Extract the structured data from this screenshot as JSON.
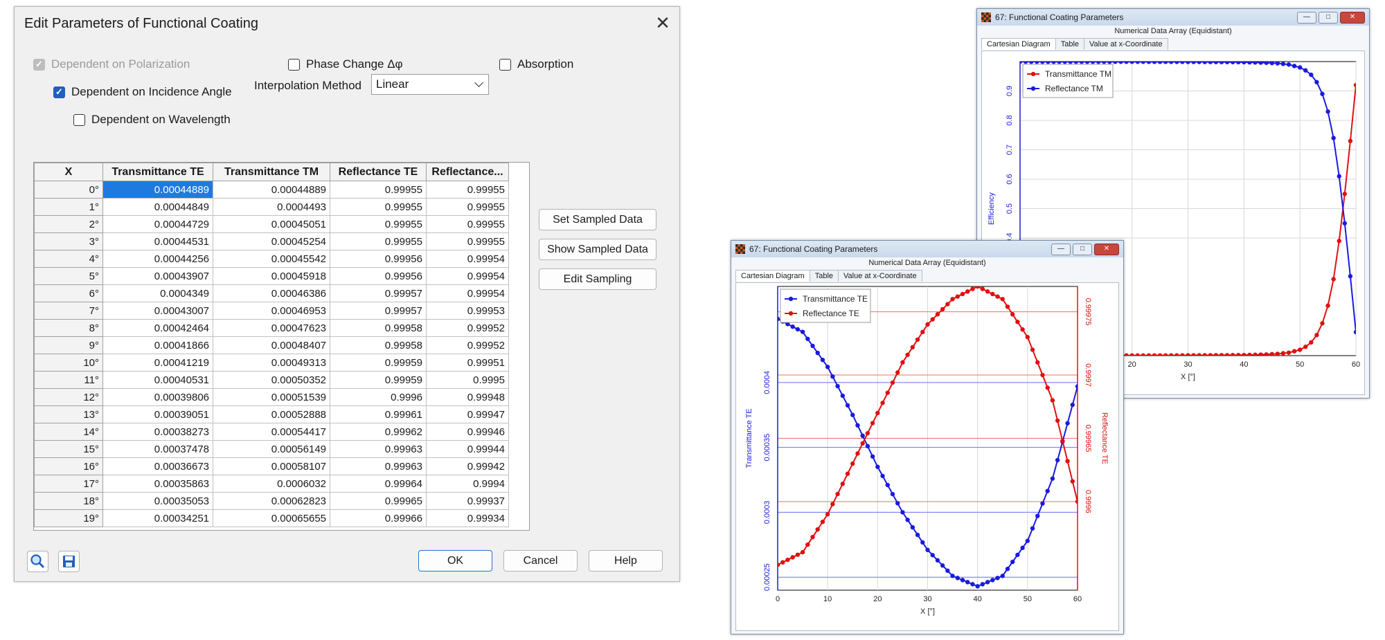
{
  "dialog": {
    "title": "Edit Parameters of Functional Coating",
    "close_glyph": "✕",
    "options": {
      "dependent_on_polarization": {
        "label": "Dependent on Polarization",
        "checked": true,
        "disabled": true
      },
      "phase_change": {
        "label": "Phase Change Δφ",
        "checked": false
      },
      "absorption": {
        "label": "Absorption",
        "checked": false
      },
      "dependent_on_incidence_angle": {
        "label": "Dependent on Incidence Angle",
        "checked": true
      },
      "dependent_on_wavelength": {
        "label": "Dependent on Wavelength",
        "checked": false
      }
    },
    "interpolation": {
      "label": "Interpolation Method",
      "value": "Linear"
    },
    "table": {
      "columns": [
        "X",
        "Transmittance TE",
        "Transmittance TM",
        "Reflectance TE",
        "Reflectance..."
      ],
      "rows": [
        [
          "0°",
          "0.00044889",
          "0.00044889",
          "0.99955",
          "0.99955"
        ],
        [
          "1°",
          "0.00044849",
          "0.0004493",
          "0.99955",
          "0.99955"
        ],
        [
          "2°",
          "0.00044729",
          "0.00045051",
          "0.99955",
          "0.99955"
        ],
        [
          "3°",
          "0.00044531",
          "0.00045254",
          "0.99955",
          "0.99955"
        ],
        [
          "4°",
          "0.00044256",
          "0.00045542",
          "0.99956",
          "0.99954"
        ],
        [
          "5°",
          "0.00043907",
          "0.00045918",
          "0.99956",
          "0.99954"
        ],
        [
          "6°",
          "0.0004349",
          "0.00046386",
          "0.99957",
          "0.99954"
        ],
        [
          "7°",
          "0.00043007",
          "0.00046953",
          "0.99957",
          "0.99953"
        ],
        [
          "8°",
          "0.00042464",
          "0.00047623",
          "0.99958",
          "0.99952"
        ],
        [
          "9°",
          "0.00041866",
          "0.00048407",
          "0.99958",
          "0.99952"
        ],
        [
          "10°",
          "0.00041219",
          "0.00049313",
          "0.99959",
          "0.99951"
        ],
        [
          "11°",
          "0.00040531",
          "0.00050352",
          "0.99959",
          "0.9995"
        ],
        [
          "12°",
          "0.00039806",
          "0.00051539",
          "0.9996",
          "0.99948"
        ],
        [
          "13°",
          "0.00039051",
          "0.00052888",
          "0.99961",
          "0.99947"
        ],
        [
          "14°",
          "0.00038273",
          "0.00054417",
          "0.99962",
          "0.99946"
        ],
        [
          "15°",
          "0.00037478",
          "0.00056149",
          "0.99963",
          "0.99944"
        ],
        [
          "16°",
          "0.00036673",
          "0.00058107",
          "0.99963",
          "0.99942"
        ],
        [
          "17°",
          "0.00035863",
          "0.0006032",
          "0.99964",
          "0.9994"
        ],
        [
          "18°",
          "0.00035053",
          "0.00062823",
          "0.99965",
          "0.99937"
        ],
        [
          "19°",
          "0.00034251",
          "0.00065655",
          "0.99966",
          "0.99934"
        ]
      ]
    },
    "buttons": {
      "set_sampled": "Set Sampled Data",
      "show_sampled": "Show Sampled Data",
      "edit_sampling": "Edit Sampling",
      "ok": "OK",
      "cancel": "Cancel",
      "help": "Help"
    },
    "icons": [
      "search-icon",
      "save-icon"
    ]
  },
  "window_back": {
    "title": "67: Functional Coating Parameters",
    "subtitle": "Numerical Data Array (Equidistant)",
    "tabs": [
      "Cartesian Diagram",
      "Table",
      "Value at x-Coordinate"
    ]
  },
  "window_front": {
    "title": "67: Functional Coating Parameters",
    "subtitle": "Numerical Data Array (Equidistant)",
    "tabs": [
      "Cartesian Diagram",
      "Table",
      "Value at x-Coordinate"
    ]
  },
  "chart_data": [
    {
      "type": "line",
      "xlabel": "X [°]",
      "ylabel": "Efficiency",
      "xlim": [
        0,
        60
      ],
      "ylim": [
        0,
        1
      ],
      "x_ticks": [
        20,
        30,
        40,
        50,
        60
      ],
      "y_ticks": [
        0.4,
        0.5,
        0.6,
        0.7,
        0.8,
        0.9
      ],
      "legend_position": "top-left",
      "series": [
        {
          "name": "Transmittance TM",
          "color": "#e01010",
          "x": [
            0,
            10,
            20,
            30,
            40,
            44,
            46,
            48,
            50,
            51,
            52,
            53,
            54,
            55,
            56,
            57,
            58,
            59,
            60
          ],
          "values": [
            0.0004,
            0.0005,
            0.0006,
            0.001,
            0.002,
            0.004,
            0.006,
            0.01,
            0.02,
            0.03,
            0.045,
            0.07,
            0.11,
            0.17,
            0.26,
            0.39,
            0.55,
            0.73,
            0.92
          ]
        },
        {
          "name": "Reflectance TM",
          "color": "#1a1ae0",
          "x": [
            0,
            10,
            20,
            30,
            40,
            44,
            46,
            48,
            50,
            51,
            52,
            53,
            54,
            55,
            56,
            57,
            58,
            59,
            60
          ],
          "values": [
            0.9996,
            0.9995,
            0.9994,
            0.999,
            0.998,
            0.996,
            0.994,
            0.99,
            0.98,
            0.97,
            0.955,
            0.93,
            0.89,
            0.83,
            0.74,
            0.61,
            0.45,
            0.27,
            0.08
          ]
        }
      ]
    },
    {
      "type": "line",
      "xlabel": "X [°]",
      "ylabel": "Transmittance TE",
      "y2label": "Reflectance TE",
      "xlim": [
        0,
        60
      ],
      "ylim": [
        0.00024,
        0.000474
      ],
      "y2lim": [
        0.99953,
        0.99977
      ],
      "x_ticks": [
        0,
        10,
        20,
        30,
        40,
        50,
        60
      ],
      "y_ticks": [
        0.00025,
        0.0003,
        0.00035,
        0.0004
      ],
      "y2_ticks": [
        0.9996,
        0.99965,
        0.9997,
        0.99975
      ],
      "legend_position": "top-left",
      "series": [
        {
          "name": "Transmittance TE",
          "color": "#1a1ae0",
          "axis": "left",
          "x": [
            0,
            5,
            10,
            15,
            20,
            25,
            30,
            35,
            40,
            45,
            50,
            55,
            60
          ],
          "values": [
            0.000449,
            0.000439,
            0.000412,
            0.000375,
            0.000335,
            0.0003,
            0.000271,
            0.000251,
            0.000243,
            0.000251,
            0.000278,
            0.000326,
            0.000397
          ]
        },
        {
          "name": "Reflectance TE",
          "color": "#e01010",
          "axis": "right",
          "x": [
            0,
            5,
            10,
            15,
            20,
            25,
            30,
            35,
            40,
            45,
            50,
            55,
            60
          ],
          "values": [
            0.99955,
            0.99956,
            0.99959,
            0.99963,
            0.99967,
            0.99971,
            0.99974,
            0.99976,
            0.99977,
            0.99976,
            0.99973,
            0.99968,
            0.9996
          ]
        }
      ]
    }
  ]
}
